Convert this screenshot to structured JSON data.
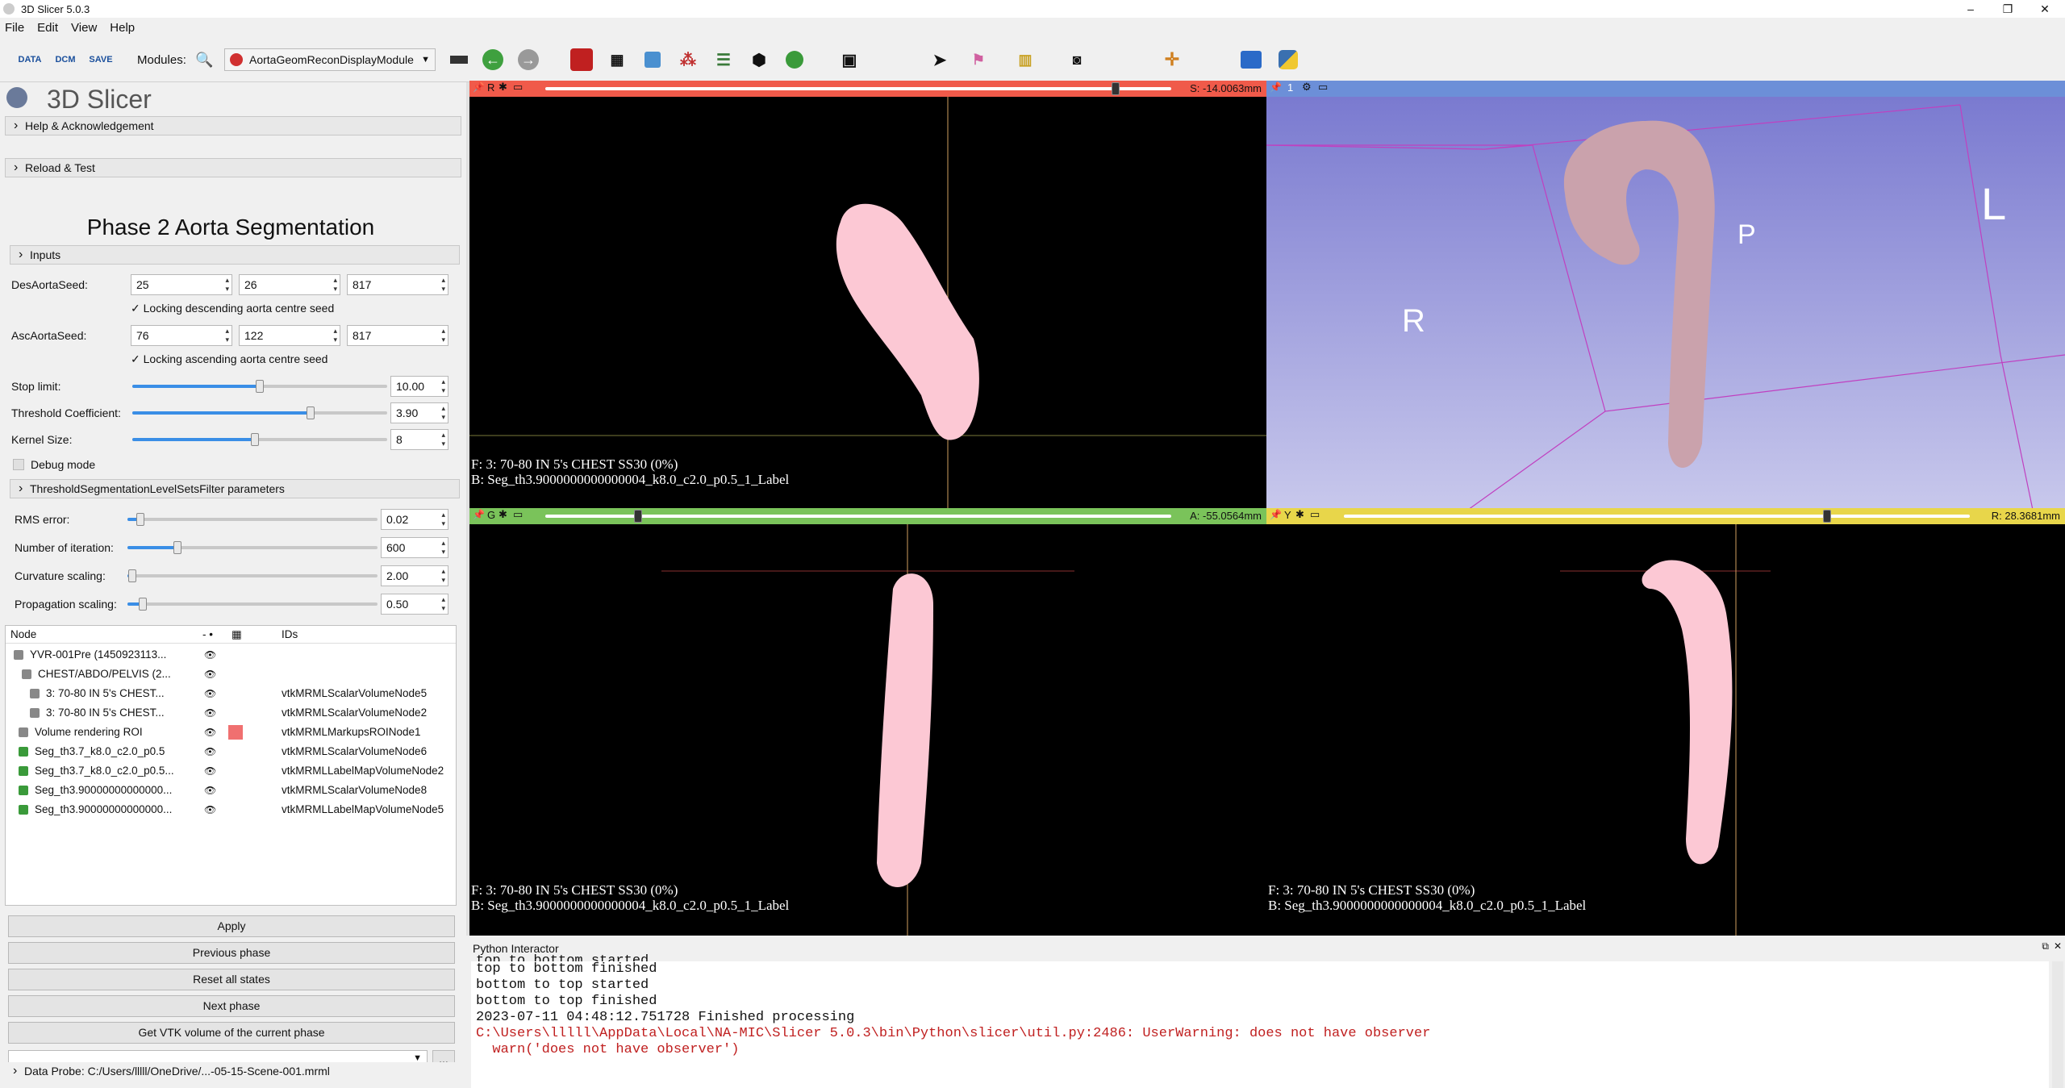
{
  "window": {
    "title": "3D Slicer 5.0.3",
    "minimize": "–",
    "maximize": "❐",
    "close": "✕"
  },
  "menu": [
    "File",
    "Edit",
    "View",
    "Help"
  ],
  "toolbar": {
    "modules_label": "Modules:",
    "module_selected": "AortaGeomReconDisplayModule",
    "data": "DATA",
    "dcm": "DCM",
    "save": "SAVE"
  },
  "panel": {
    "app_title": "3D Slicer",
    "help_section": "Help & Acknowledgement",
    "reload_section": "Reload & Test",
    "module_heading": "Phase 2 Aorta Segmentation",
    "inputs_section": "Inputs",
    "des_label": "DesAortaSeed:",
    "des": [
      "25",
      "26",
      "817"
    ],
    "des_lock": "Locking descending aorta centre seed",
    "asc_label": "AscAortaSeed:",
    "asc": [
      "76",
      "122",
      "817"
    ],
    "asc_lock": "Locking ascending aorta centre seed",
    "stop_label": "Stop limit:",
    "stop_value": "10.00",
    "stop_level": 0.5,
    "thr_label": "Threshold Coefficient:",
    "thr_value": "3.90",
    "thr_level": 0.7,
    "kernel_label": "Kernel Size:",
    "kernel_value": "8",
    "kernel_level": 0.48,
    "debug_label": "Debug mode",
    "filter_section": "ThresholdSegmentationLevelSetsFilter parameters",
    "rms_label": "RMS error:",
    "rms_value": "0.02",
    "rms_level": 0.05,
    "iter_label": "Number of iteration:",
    "iter_value": "600",
    "iter_level": 0.2,
    "curv_label": "Curvature scaling:",
    "curv_value": "2.00",
    "curv_level": 0.02,
    "prop_label": "Propagation scaling:",
    "prop_value": "0.50",
    "prop_level": 0.06,
    "tree_header": {
      "node": "Node",
      "ids": "IDs"
    },
    "tree_rows": [
      {
        "name": "YVR-001Pre (1450923113...",
        "id": ""
      },
      {
        "name": "CHEST/ABDO/PELVIS (2...",
        "id": ""
      },
      {
        "name": "3: 70-80 IN 5's  CHEST...",
        "id": "vtkMRMLScalarVolumeNode5"
      },
      {
        "name": "3: 70-80 IN 5's  CHEST...",
        "id": "vtkMRMLScalarVolumeNode2"
      },
      {
        "name": "Volume rendering ROI",
        "id": "vtkMRMLMarkupsROINode1"
      },
      {
        "name": "Seg_th3.7_k8.0_c2.0_p0.5",
        "id": "vtkMRMLScalarVolumeNode6"
      },
      {
        "name": "Seg_th3.7_k8.0_c2.0_p0.5...",
        "id": "vtkMRMLLabelMapVolumeNode2"
      },
      {
        "name": "Seg_th3.90000000000000...",
        "id": "vtkMRMLScalarVolumeNode8"
      },
      {
        "name": "Seg_th3.90000000000000...",
        "id": "vtkMRMLLabelMapVolumeNode5"
      }
    ],
    "buttons": [
      "Apply",
      "Previous phase",
      "Reset all states",
      "Next phase",
      "Get VTK volume of the current phase"
    ],
    "more": "...",
    "probe": "Data Probe: C:/Users/lllll/OneDrive/...-05-15-Scene-001.mrml"
  },
  "views": {
    "red": {
      "letter": "R",
      "value": "S: -14.0063mm",
      "f": "F: 3: 70-80 IN 5's  CHEST SS30 (0%)",
      "b": "B: Seg_th3.9000000000000004_k8.0_c2.0_p0.5_1_Label"
    },
    "green": {
      "letter": "G",
      "value": "A: -55.0564mm",
      "f": "F: 3: 70-80 IN 5's  CHEST SS30 (0%)",
      "b": "B: Seg_th3.9000000000000004_k8.0_c2.0_p0.5_1_Label"
    },
    "yellow": {
      "letter": "Y",
      "value": "R: 28.3681mm",
      "f": "F: 3: 70-80 IN 5's  CHEST SS30 (0%)",
      "b": "B: Seg_th3.9000000000000004_k8.0_c2.0_p0.5_1_Label"
    },
    "threed": {
      "number": "1",
      "label_r": "R",
      "label_p": "P",
      "label_l": "L"
    }
  },
  "python": {
    "title": "Python Interactor",
    "lines": [
      "top to bottom started",
      "top to bottom finished",
      "bottom to top started",
      "bottom to top finished",
      "2023-07-11 04:48:12.751728 Finished processing"
    ],
    "error": "C:\\Users\\lllll\\AppData\\Local\\NA-MIC\\Slicer 5.0.3\\bin\\Python\\slicer\\util.py:2486: UserWarning: does not have observer",
    "error2": "  warn('does not have observer')"
  },
  "colors": {
    "red": "#f05a4a",
    "green": "#7ac35a",
    "yellow": "#e8d64a",
    "threed": "#6c8fd8",
    "seg": "#fcc8d4",
    "aorta": "#caa2ac",
    "box": "#c040c0"
  }
}
